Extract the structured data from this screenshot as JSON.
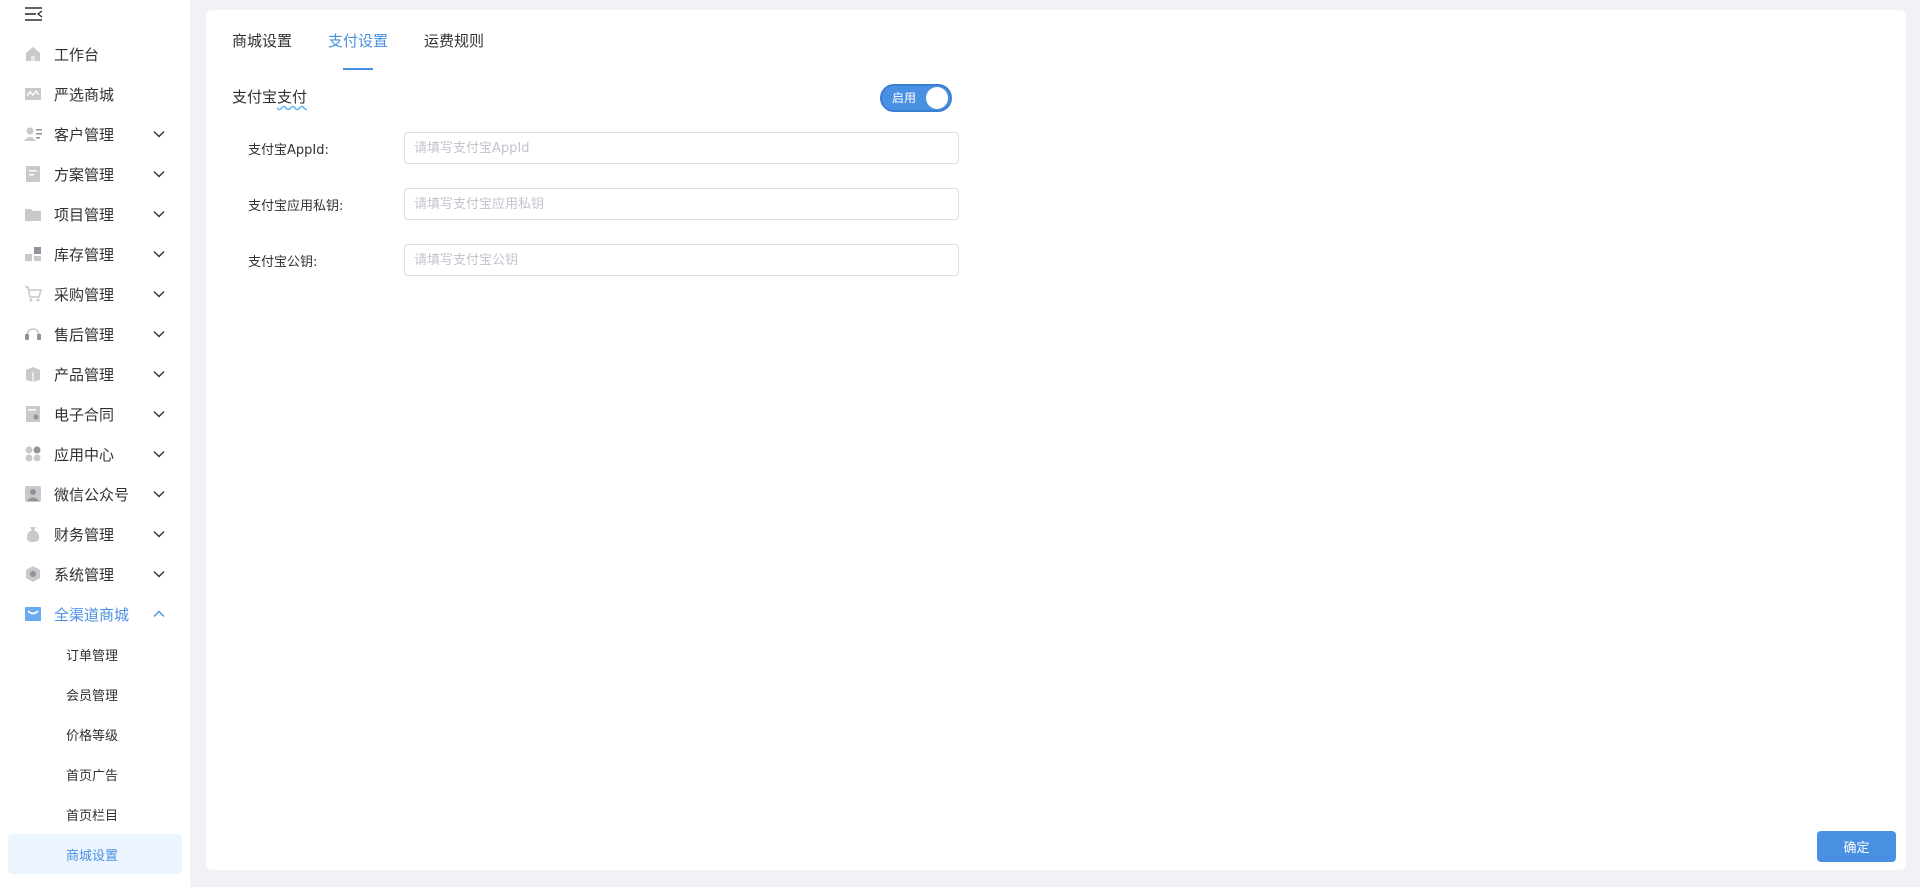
{
  "sidebar": {
    "items": [
      {
        "label": "工作台",
        "icon": "home-icon"
      },
      {
        "label": "严选商城",
        "icon": "mail-icon"
      },
      {
        "label": "客户管理",
        "icon": "user-list-icon"
      },
      {
        "label": "方案管理",
        "icon": "document-icon"
      },
      {
        "label": "项目管理",
        "icon": "folder-icon"
      },
      {
        "label": "库存管理",
        "icon": "boxes-icon"
      },
      {
        "label": "采购管理",
        "icon": "cart-icon"
      },
      {
        "label": "售后管理",
        "icon": "headset-icon"
      },
      {
        "label": "产品管理",
        "icon": "box-icon"
      },
      {
        "label": "电子合同",
        "icon": "contract-icon"
      },
      {
        "label": "应用中心",
        "icon": "apps-icon"
      },
      {
        "label": "微信公众号",
        "icon": "account-icon"
      },
      {
        "label": "财务管理",
        "icon": "money-bag-icon"
      },
      {
        "label": "系统管理",
        "icon": "settings-icon"
      },
      {
        "label": "全渠道商城",
        "icon": "shopping-bag-icon"
      }
    ],
    "submenu": [
      {
        "label": "订单管理"
      },
      {
        "label": "会员管理"
      },
      {
        "label": "价格等级"
      },
      {
        "label": "首页广告"
      },
      {
        "label": "首页栏目"
      },
      {
        "label": "商城设置"
      }
    ]
  },
  "tabs": [
    {
      "label": "商城设置"
    },
    {
      "label": "支付设置"
    },
    {
      "label": "运费规则"
    }
  ],
  "section": {
    "title_prefix": "支付宝",
    "title_underlined": "支付",
    "toggle_label": "启用"
  },
  "form": {
    "fields": [
      {
        "label": "支付宝AppId:",
        "placeholder": "请填写支付宝AppId",
        "value": ""
      },
      {
        "label": "支付宝应用私钥:",
        "placeholder": "请填写支付宝应用私钥",
        "value": ""
      },
      {
        "label": "支付宝公钥:",
        "placeholder": "请填写支付宝公钥",
        "value": ""
      }
    ],
    "confirm_label": "确定"
  },
  "colors": {
    "accent": "#4a90e2",
    "background": "#f0f2f5",
    "text": "#303133",
    "placeholder": "#c0c4cc"
  }
}
